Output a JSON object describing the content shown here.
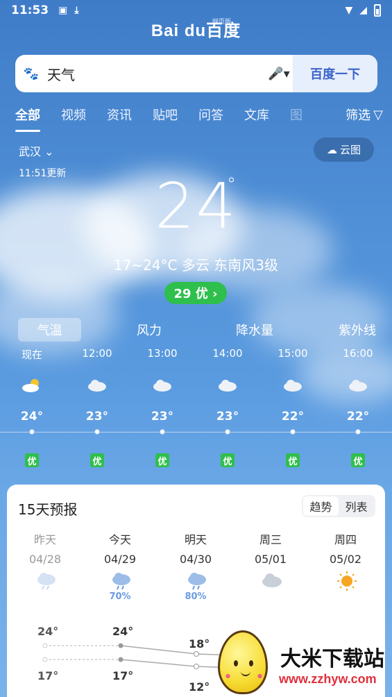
{
  "status_bar": {
    "time": "11:53"
  },
  "header": {
    "brand": "Bai du百度",
    "brand_tag": "网页版"
  },
  "search": {
    "query": "天气",
    "button": "百度一下"
  },
  "tabs": [
    {
      "label": "全部",
      "active": true
    },
    {
      "label": "视频"
    },
    {
      "label": "资讯"
    },
    {
      "label": "贴吧"
    },
    {
      "label": "问答"
    },
    {
      "label": "文库"
    },
    {
      "label": "图"
    }
  ],
  "filter_label": "筛选",
  "location": {
    "city": "武汉",
    "updated": "11:51更新",
    "map_button": "云图"
  },
  "current": {
    "temp": "24",
    "deg": "°",
    "description": "17~24°C  多云  东南风3级",
    "aqi": "29 优 ›"
  },
  "metric_tabs": [
    {
      "label": "气温",
      "active": true
    },
    {
      "label": "风力"
    },
    {
      "label": "降水量"
    },
    {
      "label": "紫外线"
    }
  ],
  "hourly": [
    {
      "time": "现在",
      "temp": "24°",
      "aqi": "优",
      "icon": "partly-sunny-icon"
    },
    {
      "time": "12:00",
      "temp": "23°",
      "aqi": "优",
      "icon": "cloudy-icon"
    },
    {
      "time": "13:00",
      "temp": "23°",
      "aqi": "优",
      "icon": "cloudy-icon"
    },
    {
      "time": "14:00",
      "temp": "23°",
      "aqi": "优",
      "icon": "cloudy-icon"
    },
    {
      "time": "15:00",
      "temp": "22°",
      "aqi": "优",
      "icon": "cloudy-icon"
    },
    {
      "time": "16:00",
      "temp": "22°",
      "aqi": "优",
      "icon": "cloudy-icon"
    }
  ],
  "forecast": {
    "title": "15天预报",
    "toggle": [
      {
        "label": "趋势",
        "active": true
      },
      {
        "label": "列表"
      }
    ],
    "days": [
      {
        "name": "昨天",
        "date": "04/28",
        "icon": "rain-cloud-icon",
        "pop": "",
        "high": "24°",
        "low": "17°"
      },
      {
        "name": "今天",
        "date": "04/29",
        "icon": "rain-cloud-icon",
        "pop": "70%",
        "high": "24°",
        "low": "17°"
      },
      {
        "name": "明天",
        "date": "04/30",
        "icon": "rain-cloud-icon",
        "pop": "80%",
        "high": "18°",
        "low": "12°"
      },
      {
        "name": "周三",
        "date": "05/01",
        "icon": "cloudy-icon",
        "pop": ""
      },
      {
        "name": "周四",
        "date": "05/02",
        "icon": "sun-icon",
        "pop": ""
      }
    ]
  },
  "watermark": {
    "title": "大米下载站",
    "url": "www.zzhyw.com"
  },
  "colors": {
    "aqi_good": "#2fbf4c",
    "accent": "#3a64c8"
  }
}
